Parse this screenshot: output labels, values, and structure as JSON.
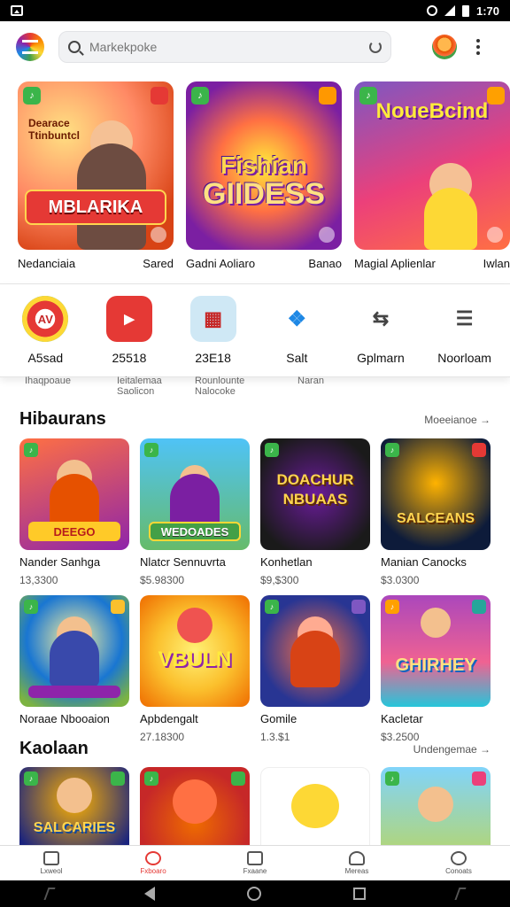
{
  "status_bar": {
    "time": "1:70"
  },
  "search": {
    "placeholder": "Markekpoke"
  },
  "featured": [
    {
      "caption_left": "Nedanciaia",
      "caption_right": "Sared",
      "art_text_top": "Dearace Ttinbuntcl",
      "art_banner": "MBLARIKA",
      "colors": [
        "#d84315",
        "#ffb300"
      ]
    },
    {
      "caption_left": "Gadni Aoliaro",
      "caption_right": "Banao",
      "art_text_top": "Fishian",
      "art_banner": "GIIDESS",
      "colors": [
        "#6a1b9a",
        "#ff6f00"
      ]
    },
    {
      "caption_left": "Magial Aplienlar",
      "caption_right": "Iwlan",
      "art_text_top": "NoueBcind",
      "art_banner": "",
      "colors": [
        "#8e24aa",
        "#e91e63"
      ]
    }
  ],
  "quick_links": [
    {
      "label": "A5sad",
      "icon": "media-icon",
      "color": "#e53935"
    },
    {
      "label": "25518",
      "icon": "video-icon",
      "color": "#e53935"
    },
    {
      "label": "23E18",
      "icon": "calendar-icon",
      "color": "#cfe8f5"
    },
    {
      "label": "Salt",
      "icon": "blocks-icon",
      "color": "#ffffff"
    },
    {
      "label": "Gplmarn",
      "icon": "share-icon",
      "color": "#ffffff"
    },
    {
      "label": "Noorloam",
      "icon": "list-icon",
      "color": "#ffffff"
    }
  ],
  "quick_sub": [
    "Ihaqpoaue",
    "Ieitalemaa Saolicon",
    "Rounlounte Nalocoke",
    "Naran"
  ],
  "section1": {
    "title": "Hibaurans",
    "more": "Moeeianoe →",
    "items": [
      {
        "name": "Nander Sanhga",
        "price": "13,3300",
        "art": "DEEGO",
        "colors": [
          "#ff7043",
          "#8e24aa"
        ]
      },
      {
        "name": "Nlatcr Sennuvrta",
        "price": "$5.98300",
        "art": "WEDOADES",
        "colors": [
          "#4fc3f7",
          "#66bb6a"
        ]
      },
      {
        "name": "Konhetlan",
        "price": "$9,$300",
        "art": "DOACHUR NBUAAS",
        "colors": [
          "#212121",
          "#4a148c"
        ]
      },
      {
        "name": "Manian Canocks",
        "price": "$3.0300",
        "art": "SALCEANS",
        "colors": [
          "#0d47a1",
          "#ff8f00"
        ]
      },
      {
        "name": "Noraae Nbooaion",
        "price": "",
        "art": "",
        "colors": [
          "#1976d2",
          "#7cb342"
        ]
      },
      {
        "name": "Apbdengalt",
        "price": "27.18300",
        "art": "VBULN",
        "colors": [
          "#fbc02d",
          "#ef6c00"
        ]
      },
      {
        "name": "Gomile",
        "price": "1.3.$1",
        "art": "",
        "colors": [
          "#283593",
          "#d84315"
        ]
      },
      {
        "name": "Kacletar",
        "price": "$3.2500",
        "art": "GHIRHEY",
        "colors": [
          "#ab47bc",
          "#26c6da"
        ]
      }
    ]
  },
  "section2": {
    "title": "Kaolaan",
    "more": "Undengemae →",
    "items": [
      {
        "art": "SALCARIES",
        "colors": [
          "#1a237e",
          "#ff6f00"
        ]
      },
      {
        "art": "",
        "colors": [
          "#c62828",
          "#ef6c00"
        ]
      },
      {
        "art": "",
        "colors": [
          "#ffffff",
          "#fdd835"
        ]
      },
      {
        "art": "",
        "colors": [
          "#81d4fa",
          "#7cb342"
        ]
      }
    ]
  },
  "bottom_nav": [
    {
      "label": "Lxweol",
      "active": false
    },
    {
      "label": "Fxboaro",
      "active": true
    },
    {
      "label": "Fxaane",
      "active": false
    },
    {
      "label": "Mereas",
      "active": false
    },
    {
      "label": "Conoats",
      "active": false
    }
  ]
}
